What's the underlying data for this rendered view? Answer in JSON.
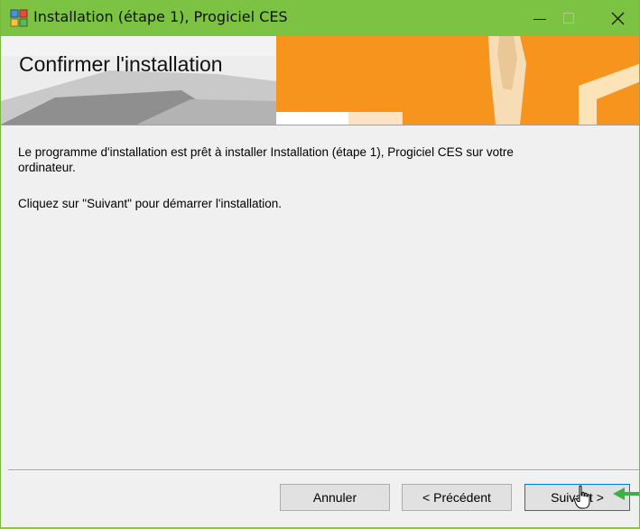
{
  "window": {
    "title": "Installation (étape 1), Progiciel CES",
    "app_icon": "installer-icon",
    "titlebar_color": "#7cc243",
    "controls": [
      "minimize-icon",
      "maximize-icon",
      "close-icon"
    ]
  },
  "banner": {
    "heading": "Confirmer l'installation",
    "accent_color": "#f7941e"
  },
  "content": {
    "line1": "Le programme d'installation est prêt à installer Installation (étape 1), Progiciel CES sur votre",
    "line2": "ordinateur.",
    "line3": "Cliquez sur \"Suivant\" pour démarrer l'installation."
  },
  "buttons": {
    "cancel": "Annuler",
    "previous": "< Précédent",
    "next": "Suivant >"
  },
  "annotations": {
    "arrow_color": "#3cb043"
  }
}
